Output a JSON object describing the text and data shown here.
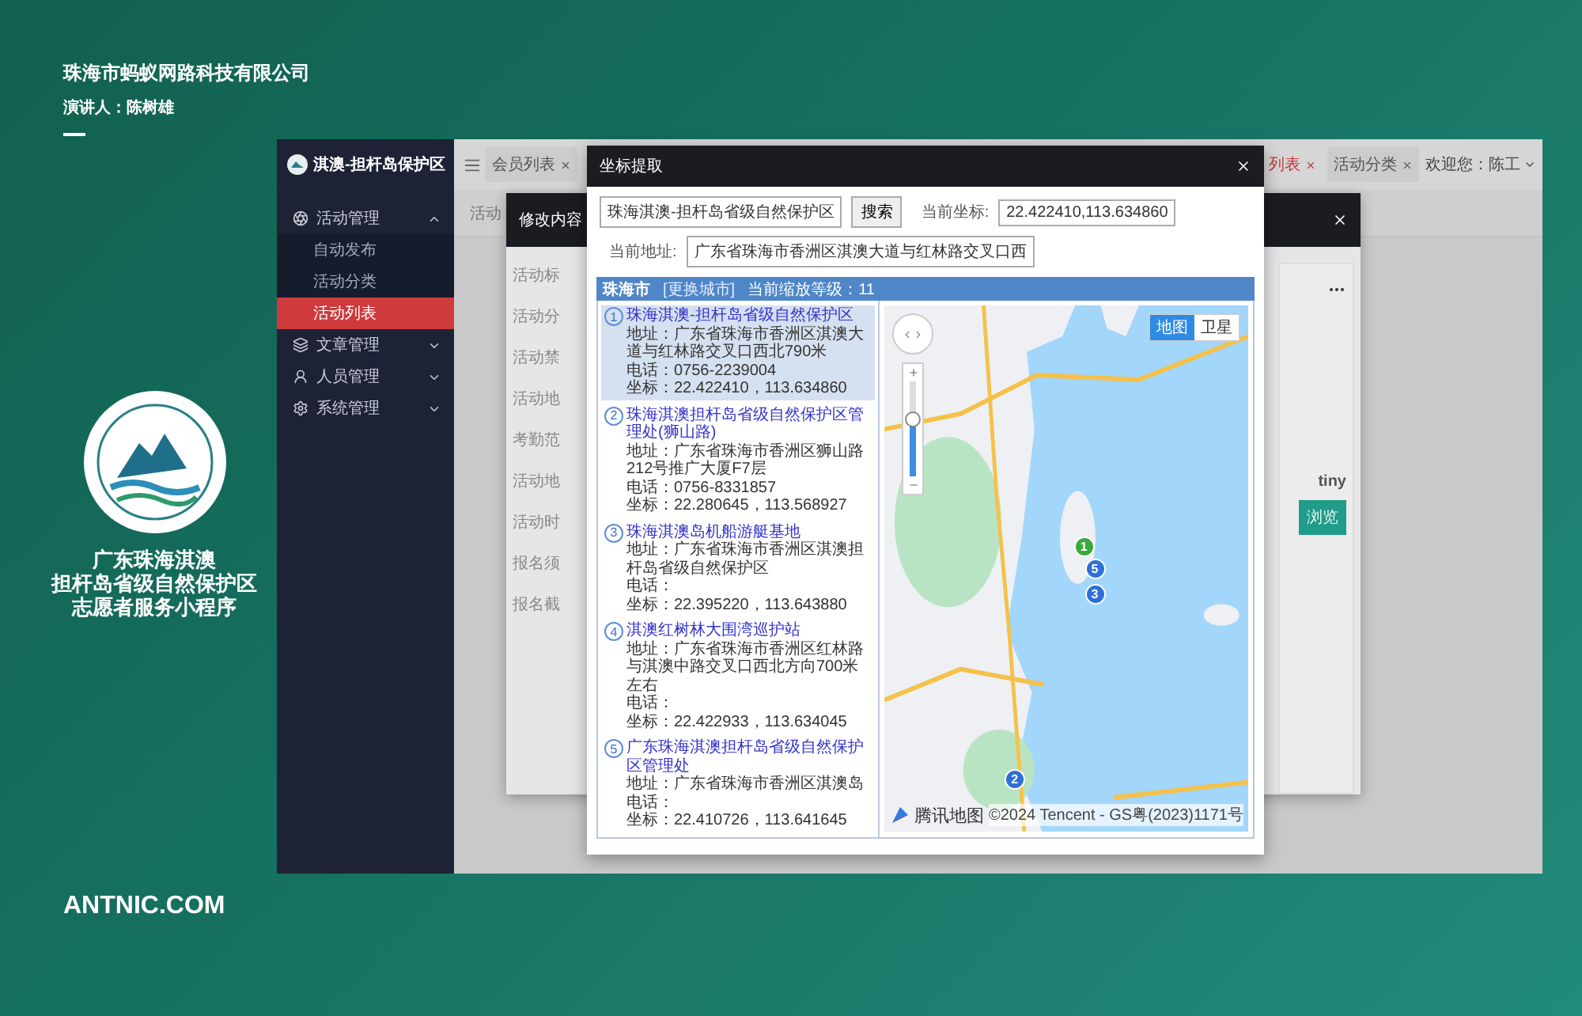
{
  "slide": {
    "company": "珠海市蚂蚁网路科技有限公司",
    "presenter": "演讲人：陈树雄",
    "title_lines": [
      "广东珠海淇澳",
      "担杆岛省级自然保护区",
      "志愿者服务小程序"
    ],
    "website": "ANTNIC.COM"
  },
  "app": {
    "logo_text": "淇澳-担杆岛保护区",
    "sidebar": [
      {
        "label": "活动管理",
        "expanded": true,
        "children": [
          {
            "label": "自动发布",
            "selected": false
          },
          {
            "label": "活动分类",
            "selected": false
          },
          {
            "label": "活动列表",
            "selected": true
          }
        ]
      },
      {
        "label": "文章管理",
        "expanded": false
      },
      {
        "label": "人员管理",
        "expanded": false
      },
      {
        "label": "系统管理",
        "expanded": false
      }
    ],
    "tabs": [
      {
        "label": "会员列表",
        "selected": false
      },
      {
        "label": "列表",
        "selected": true
      },
      {
        "label": "活动分类",
        "selected": false
      }
    ],
    "user": "欢迎您：陈工",
    "breadcrumb": "活动"
  },
  "edit_dialog": {
    "title": "修改内容",
    "form_labels": [
      "活动标",
      "活动分",
      "活动禁",
      "活动地",
      "考勤范",
      "活动地",
      "活动时",
      "报名须",
      "报名截"
    ],
    "editor_name": "tiny",
    "browse_button": "浏览"
  },
  "coord_dialog": {
    "title": "坐标提取",
    "search_value": "珠海淇澳-担杆岛省级自然保护区",
    "search_button": "搜索",
    "coord_label": "当前坐标:",
    "coord_value": "22.422410,113.634860",
    "address_label": "当前地址:",
    "address_value": "广东省珠海市香洲区淇澳大道与红林路交叉口西",
    "city": "珠海市",
    "change_city": "[更换城市]",
    "zoom_text": "当前缩放等级：11",
    "results": [
      {
        "number": "1",
        "name": "珠海淇澳-担杆岛省级自然保护区",
        "address": "地址：广东省珠海市香洲区淇澳大道与红林路交叉口西北790米",
        "phone": "电话：0756-2239004",
        "coord": "坐标：22.422410，113.634860",
        "selected": true
      },
      {
        "number": "2",
        "name": "珠海淇澳担杆岛省级自然保护区管理处(狮山路)",
        "address": "地址：广东省珠海市香洲区狮山路212号推广大厦F7层",
        "phone": "电话：0756-8331857",
        "coord": "坐标：22.280645，113.568927",
        "selected": false
      },
      {
        "number": "3",
        "name": "珠海淇澳岛机船游艇基地",
        "address": "地址：广东省珠海市香洲区淇澳担杆岛省级自然保护区",
        "phone": "电话：",
        "coord": "坐标：22.395220，113.643880",
        "selected": false
      },
      {
        "number": "4",
        "name": "淇澳红树林大围湾巡护站",
        "address": "地址：广东省珠海市香洲区红林路与淇澳中路交叉口西北方向700米左右",
        "phone": "电话：",
        "coord": "坐标：22.422933，113.634045",
        "selected": false
      },
      {
        "number": "5",
        "name": "广东珠海淇澳担杆岛省级自然保护区管理处",
        "address": "地址：广东省珠海市香洲区淇澳岛",
        "phone": "电话：",
        "coord": "坐标：22.410726，113.641645",
        "selected": false
      }
    ],
    "map_types": [
      {
        "label": "地图",
        "selected": true
      },
      {
        "label": "卫星",
        "selected": false
      }
    ],
    "map_markers": [
      {
        "label": "1",
        "selected": true
      },
      {
        "label": "5",
        "selected": false
      },
      {
        "label": "3",
        "selected": false
      },
      {
        "label": "2",
        "selected": false
      }
    ],
    "zoom_slider": {
      "level": 0.6
    },
    "map_brand": "腾讯地图",
    "map_copyright": "©2024 Tencent - GS粤(2023)1171号"
  }
}
